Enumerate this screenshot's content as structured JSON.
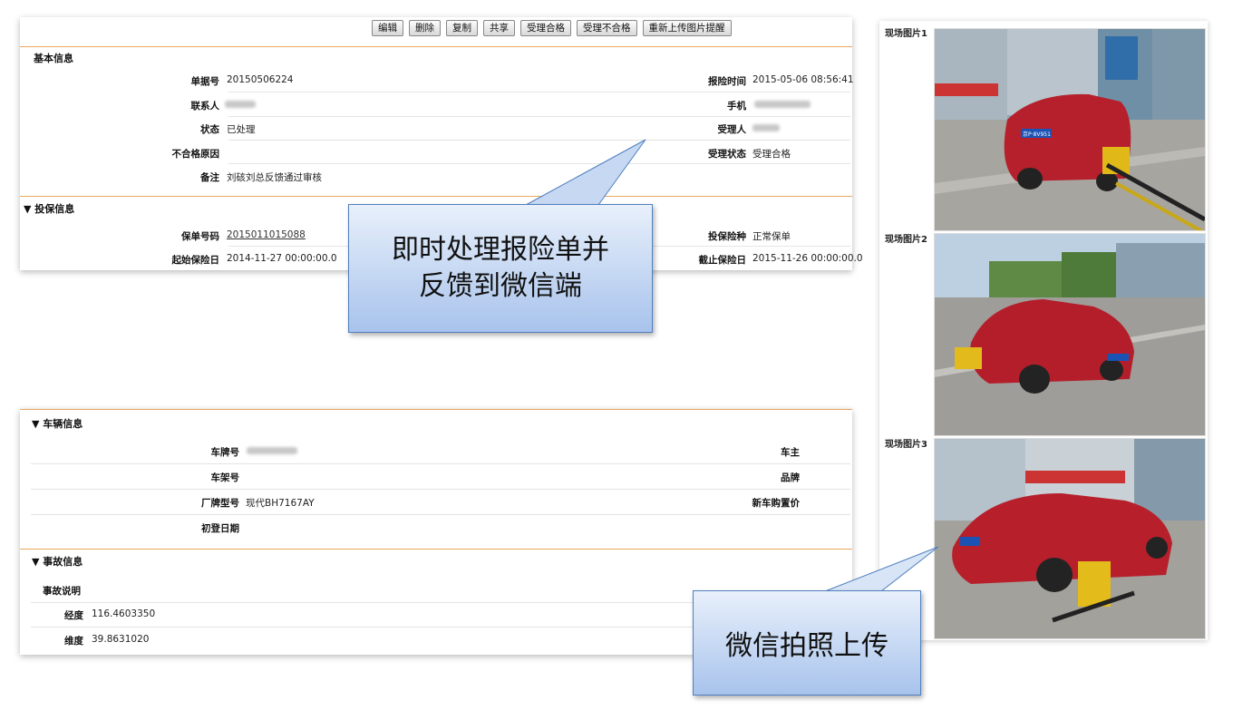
{
  "toolbar": {
    "buttons": [
      "编辑",
      "删除",
      "复制",
      "共享",
      "受理合格",
      "受理不合格",
      "重新上传图片提醒"
    ]
  },
  "basic": {
    "title": "基本信息",
    "order_no_label": "单据号",
    "order_no": "20150506224",
    "report_time_label": "报险时间",
    "report_time": "2015-05-06 08:56:41",
    "contact_label": "联系人",
    "phone_label": "手机",
    "status_label": "状态",
    "status": "已处理",
    "handler_label": "受理人",
    "reject_reason_label": "不合格原因",
    "accept_status_label": "受理状态",
    "accept_status": "受理合格",
    "remark_label": "备注",
    "remark": "刘硋刘总反馈通过审核"
  },
  "insurance": {
    "title": "▼ 投保信息",
    "policy_no_label": "保单号码",
    "policy_no": "2015011015088",
    "policy_type_label": "投保险种",
    "policy_type": "正常保单",
    "start_label": "起始保险日",
    "start": "2014-11-27 00:00:00.0",
    "end_label": "截止保险日",
    "end": "2015-11-26 00:00:00.0"
  },
  "vehicle": {
    "title": "▼ 车辆信息",
    "plate_label": "车牌号",
    "owner_label": "车主",
    "frame_label": "车架号",
    "brand_label": "品牌",
    "model_label": "厂牌型号",
    "model": "现代BH7167AY",
    "price_label": "新车购置价",
    "reg_date_label": "初登日期"
  },
  "accident": {
    "title": "▼ 事故信息",
    "desc_label": "事故说明",
    "lng_label": "经度",
    "lng": "116.4603350",
    "lat_label": "维度",
    "lat": "39.8631020"
  },
  "photos": {
    "labels": [
      "现场图片1",
      "现场图片2",
      "现场图片3"
    ],
    "plate_text": "京P·8V951"
  },
  "callouts": {
    "top_line1": "即时处理报险单并",
    "top_line2": "反馈到微信端",
    "bottom": "微信拍照上传",
    "fill_top": "#e8f0fb",
    "fill_bottom": "#a8c3ec",
    "border": "#4f7fbf"
  }
}
